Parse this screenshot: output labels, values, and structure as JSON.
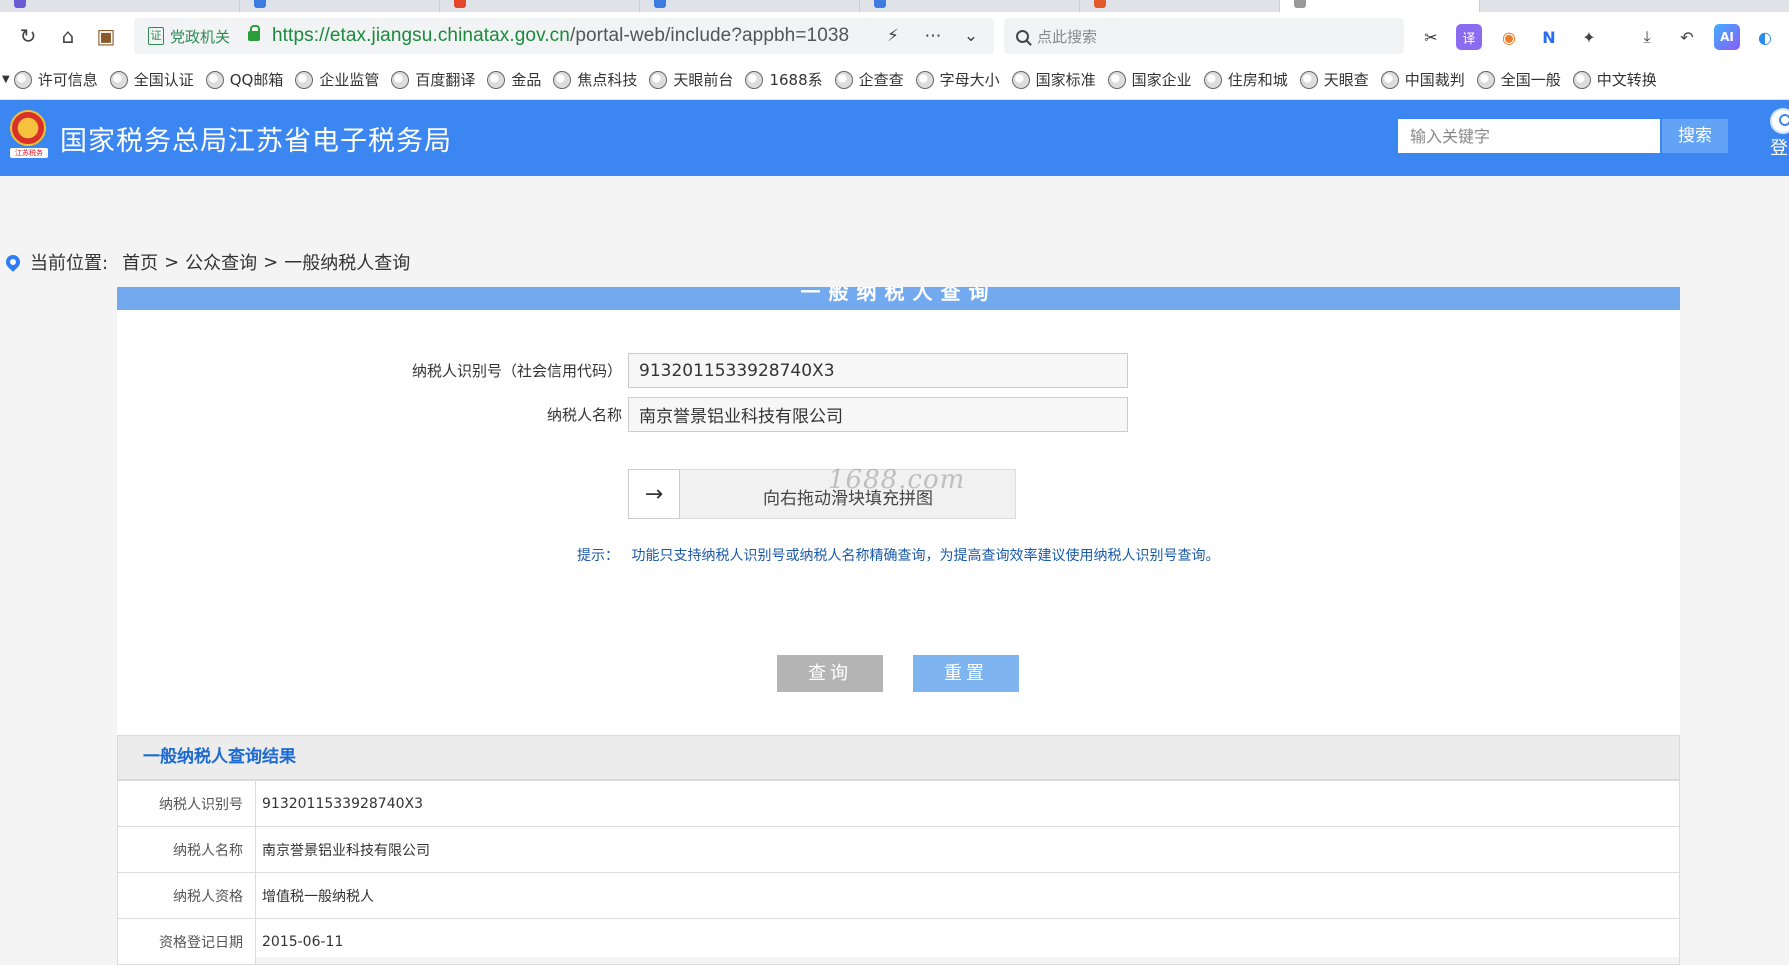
{
  "browser": {
    "gov_badge": "党政机关",
    "url_scheme": "https://",
    "url_host": "etax.jiangsu.chinatax.gov.cn",
    "url_path": "/portal-web/include?appbh=1038",
    "search_placeholder": "点此搜索",
    "bookmarks": [
      "许可信息",
      "全国认证",
      "QQ邮箱",
      "企业监管",
      "百度翻译",
      "金品",
      "焦点科技",
      "天眼前台",
      "1688系",
      "企查查",
      "字母大小",
      "国家标准",
      "国家企业",
      "住房和城",
      "天眼查",
      "中国裁判",
      "全国一般",
      "中文转换"
    ]
  },
  "site": {
    "title": "国家税务总局江苏省电子税务局",
    "emblem_caption": "江苏税务",
    "keyword_placeholder": "输入关键字",
    "search_button": "搜索",
    "login_label": "登"
  },
  "breadcrumb": {
    "prefix": "当前位置:",
    "items": [
      "首页",
      "公众查询",
      "一般纳税人查询"
    ],
    "separator": ">"
  },
  "form": {
    "panel_title": "一般纳税人查询",
    "taxpayer_id_label": "纳税人识别号（社会信用代码）",
    "taxpayer_id_value": "9132011533928740X3",
    "taxpayer_name_label": "纳税人名称",
    "taxpayer_name_value": "南京誉景铝业科技有限公司",
    "slider_text": "向右拖动滑块填充拼图",
    "slider_handle": "→",
    "watermark": "1688.com",
    "tip_label": "提示：",
    "tip_text": "功能只支持纳税人识别号或纳税人名称精确查询，为提高查询效率建议使用纳税人识别号查询。",
    "query_button": "查询",
    "reset_button": "重置"
  },
  "result": {
    "title": "一般纳税人查询结果",
    "rows": [
      {
        "label": "纳税人识别号",
        "value": "9132011533928740X3"
      },
      {
        "label": "纳税人名称",
        "value": "南京誉景铝业科技有限公司"
      },
      {
        "label": "纳税人资格",
        "value": "增值税一般纳税人"
      },
      {
        "label": "资格登记日期",
        "value": "2015-06-11"
      }
    ]
  },
  "colors": {
    "header_blue": "#3b86f0",
    "panel_head_blue": "#73a9ef",
    "result_title_blue": "#1d6ad0",
    "query_gray": "#b4b4b4",
    "reset_blue": "#7eb4ef"
  }
}
